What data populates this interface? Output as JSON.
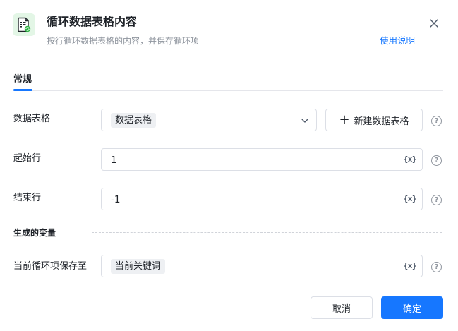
{
  "dialog": {
    "title": "循环数据表格内容",
    "subtitle": "按行循环数据表格的内容，并保存循环项",
    "help_link": "使用说明",
    "icon": "spreadsheet-loop-icon",
    "accent_color": "#1677ff",
    "icon_color": "#2fb344"
  },
  "tabs": [
    {
      "label": "常规",
      "active": true
    }
  ],
  "fields": {
    "data_table": {
      "label": "数据表格",
      "value": "数据表格",
      "new_button": "新建数据表格"
    },
    "start_row": {
      "label": "起始行",
      "value": "1"
    },
    "end_row": {
      "label": "结束行",
      "value": "-1"
    },
    "var_icon": "{x}",
    "help_icon": "?"
  },
  "variables_section": {
    "title": "生成的变量",
    "save_to": {
      "label": "当前循环项保存至",
      "value": "当前关键词"
    }
  },
  "footer": {
    "cancel_label": "取消",
    "confirm_label": "确定"
  }
}
